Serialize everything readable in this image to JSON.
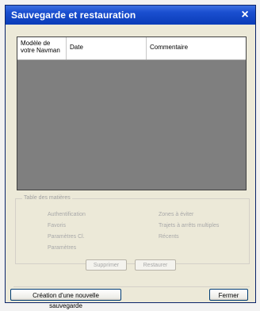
{
  "window": {
    "title": "Sauvegarde et restauration",
    "close_glyph": "×"
  },
  "backups_list": {
    "columns": [
      "Modèle de votre Navman",
      "Date",
      "Commentaire"
    ],
    "rows": []
  },
  "toc": {
    "legend": "Table des matières",
    "items_left": [
      "Authentification",
      "Favoris",
      "Paramètres Cl.",
      "Paramètres"
    ],
    "items_right": [
      "Zones à éviter",
      "Trajets à arrêts multiples",
      "Récents"
    ]
  },
  "actions": {
    "delete_label": "Supprimer",
    "restore_label": "Restaurer",
    "new_backup_label": "Création d'une nouvelle sauvegarde",
    "close_label": "Fermer"
  },
  "colors": {
    "titlebar": "#0a3cb8",
    "list_background": "#7f7f7f",
    "dialog_background": "#ece9d8"
  }
}
